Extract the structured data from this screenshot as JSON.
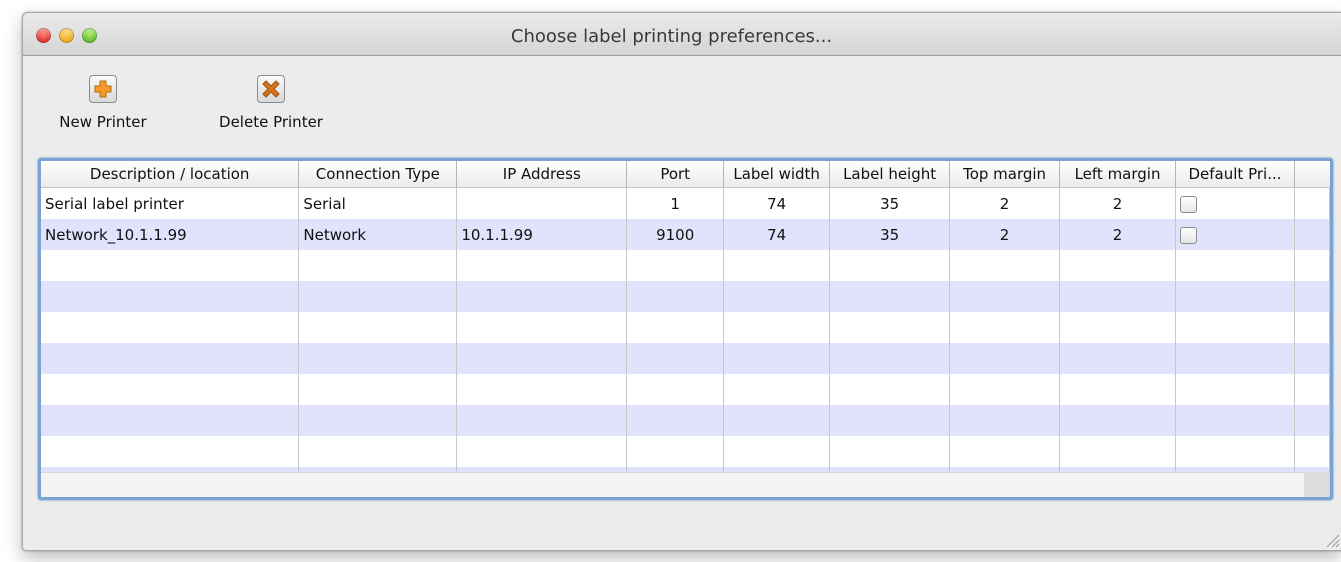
{
  "window": {
    "title": "Choose label printing preferences..."
  },
  "toolbar": {
    "new_printer": {
      "label": "New Printer",
      "icon": "plus-icon",
      "color": "#f29b2a"
    },
    "delete_printer": {
      "label": "Delete Printer",
      "icon": "x-icon",
      "color": "#d9741e"
    }
  },
  "table": {
    "columns": [
      "Description / location",
      "Connection Type",
      "IP Address",
      "Port",
      "Label width",
      "Label height",
      "Top margin",
      "Left margin",
      "Default Pri..."
    ],
    "rows": [
      {
        "description": "Serial label printer",
        "connection": "Serial",
        "ip": "",
        "port": "1",
        "label_width": "74",
        "label_height": "35",
        "top_margin": "2",
        "left_margin": "2",
        "default": false
      },
      {
        "description": "Network_10.1.1.99",
        "connection": "Network",
        "ip": "10.1.1.99",
        "port": "9100",
        "label_width": "74",
        "label_height": "35",
        "top_margin": "2",
        "left_margin": "2",
        "default": false
      }
    ]
  },
  "colors": {
    "stripe": "#e0e3fb",
    "focus_ring": "#7aa3d4"
  }
}
